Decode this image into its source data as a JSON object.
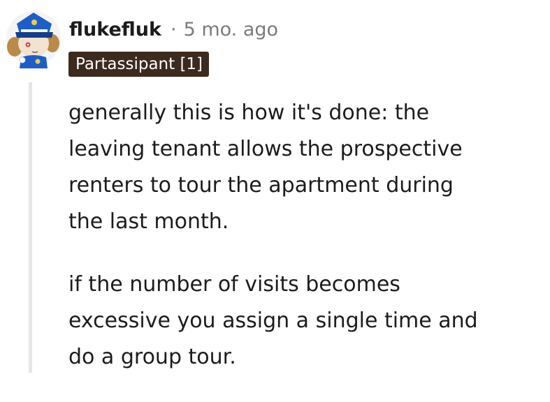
{
  "comment": {
    "username": "flukefluk",
    "separator": "·",
    "timestamp": "5 mo. ago",
    "flair": "Partassipant [1]",
    "paragraphs": [
      [
        "generally this is how it's done: the",
        "leaving tenant allows the prospective",
        "renters to tour the apartment during",
        "the last month."
      ],
      [
        "if the number of visits becomes",
        "excessive you assign a single time and",
        "do a group tour."
      ]
    ]
  },
  "colors": {
    "flair_background": "#3d2a1e",
    "thread_line": "#e4e6e8",
    "meta_text": "#7c7c7c"
  },
  "icons": {
    "avatar": "police-officer-avatar"
  }
}
